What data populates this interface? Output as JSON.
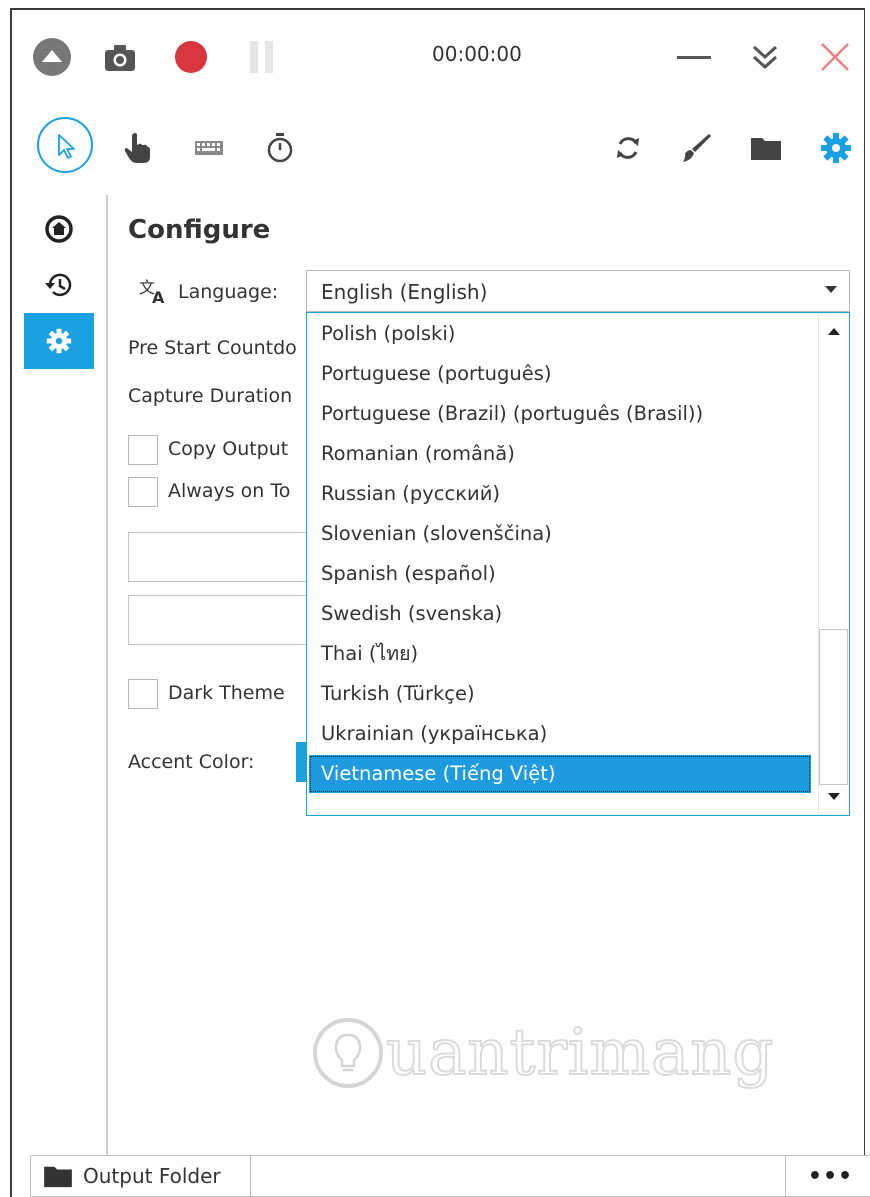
{
  "titlebar": {
    "timer": "00:00:00",
    "icons": [
      "collapse-up-icon",
      "camera-icon",
      "record-icon",
      "pause-icon",
      "minimize-icon",
      "chevron-double-down-icon",
      "close-icon"
    ],
    "record_color": "#d9363e",
    "close_color": "#f08080"
  },
  "toolbar": {
    "icons": [
      "cursor-icon",
      "hand-icon",
      "keyboard-icon",
      "stopwatch-icon",
      "refresh-icon",
      "brush-icon",
      "folder-icon",
      "gear-icon"
    ],
    "accent": "#1ba1e2"
  },
  "sidebar": {
    "items": [
      {
        "icon": "home-icon",
        "active": false
      },
      {
        "icon": "history-icon",
        "active": false
      },
      {
        "icon": "gear-icon",
        "active": true
      }
    ]
  },
  "configure": {
    "heading": "Configure",
    "language_label": "Language:",
    "language_value": "English (English)",
    "pre_start_label": "Pre Start Countdo",
    "capture_duration_label": "Capture Duration",
    "copy_output_label": "Copy Output",
    "always_on_top_label": "Always on To",
    "dark_theme_label": "Dark Theme",
    "accent_color_label": "Accent Color:"
  },
  "language_dropdown": {
    "options": [
      "Polish (polski)",
      "Portuguese (português)",
      "Portuguese (Brazil) (português (Brasil))",
      "Romanian (română)",
      "Russian (русский)",
      "Slovenian (slovenščina)",
      "Spanish (español)",
      "Swedish (svenska)",
      "Thai (ไทย)",
      "Turkish (Türkçe)",
      "Ukrainian (українська)",
      "Vietnamese (Tiếng Việt)"
    ],
    "selected_index": 11
  },
  "bottombar": {
    "output_folder_label": "Output Folder",
    "more_label": "•••"
  },
  "watermark": {
    "text": "uantrimang"
  }
}
